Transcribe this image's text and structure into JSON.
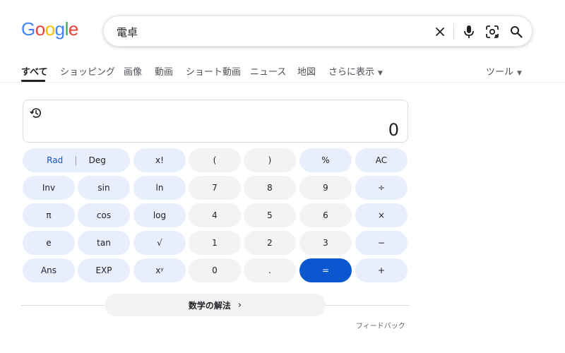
{
  "logo": {
    "letters": [
      {
        "ch": "G",
        "color": "#4285F4"
      },
      {
        "ch": "o",
        "color": "#EA4335"
      },
      {
        "ch": "o",
        "color": "#FBBC05"
      },
      {
        "ch": "g",
        "color": "#4285F4"
      },
      {
        "ch": "l",
        "color": "#34A853"
      },
      {
        "ch": "e",
        "color": "#EA4335"
      }
    ]
  },
  "search": {
    "query": "電卓",
    "icons": [
      "close-icon",
      "microphone-icon",
      "lens-icon",
      "search-icon"
    ]
  },
  "tabs": {
    "all": "すべて",
    "shopping": "ショッピング",
    "images": "画像",
    "videos": "動画",
    "short_videos": "ショート動画",
    "news": "ニュース",
    "maps": "地図",
    "more": "さらに表示",
    "tools": "ツール"
  },
  "calculator": {
    "display_value": "0",
    "keys": {
      "rad": "Rad",
      "deg": "Deg",
      "fact": "x!",
      "lparen": "(",
      "rparen": ")",
      "percent": "%",
      "ac": "AC",
      "inv": "Inv",
      "sin": "sin",
      "ln": "ln",
      "seven": "7",
      "eight": "8",
      "nine": "9",
      "divide": "÷",
      "pi": "π",
      "cos": "cos",
      "log": "log",
      "four": "4",
      "five": "5",
      "six": "6",
      "multiply": "×",
      "e": "e",
      "tan": "tan",
      "sqrt": "√",
      "one": "1",
      "two": "2",
      "three": "3",
      "minus": "−",
      "ans": "Ans",
      "exp": "EXP",
      "power": "xʸ",
      "zero": "0",
      "dot": ".",
      "equals": "=",
      "plus": "+"
    }
  },
  "solve_button": "数学の解法",
  "feedback": "フィードバック",
  "colors": {
    "accent": "#0b57d0",
    "function_key": "#e8eefc",
    "number_key": "#f1f3f4"
  }
}
